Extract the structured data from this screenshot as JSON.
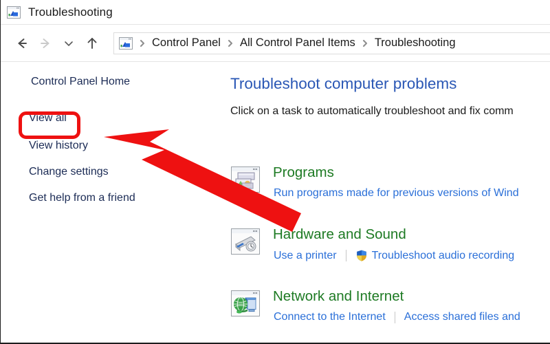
{
  "window": {
    "title": "Troubleshooting",
    "icon": "troubleshooting-window-icon"
  },
  "toolbar": {
    "back_icon": "back-arrow-icon",
    "forward_icon": "forward-arrow-icon",
    "recent_icon": "chevron-down-icon",
    "up_icon": "up-arrow-icon",
    "address_icon": "control-panel-icon",
    "breadcrumb": [
      "Control Panel",
      "All Control Panel Items",
      "Troubleshooting"
    ],
    "separator_icon": "chevron-right-icon"
  },
  "sidebar": {
    "home_label": "Control Panel Home",
    "items": [
      {
        "label": "View all"
      },
      {
        "label": "View history"
      },
      {
        "label": "Change settings"
      },
      {
        "label": "Get help from a friend"
      }
    ]
  },
  "main": {
    "title": "Troubleshoot computer problems",
    "subtitle": "Click on a task to automatically troubleshoot and fix comm",
    "categories": [
      {
        "icon": "programs-icon",
        "title": "Programs",
        "links": [
          {
            "label": "Run programs made for previous versions of Wind",
            "shield": false
          }
        ]
      },
      {
        "icon": "hardware-and-sound-icon",
        "title": "Hardware and Sound",
        "links": [
          {
            "label": "Use a printer",
            "shield": false
          },
          {
            "label": "Troubleshoot audio recording",
            "shield": true
          }
        ]
      },
      {
        "icon": "network-and-internet-icon",
        "title": "Network and Internet",
        "links": [
          {
            "label": "Connect to the Internet",
            "shield": false
          },
          {
            "label": "Access shared files and",
            "shield": false
          }
        ]
      }
    ]
  },
  "annotations": {
    "highlight_color": "#ee1111",
    "arrow_color": "#ee1111",
    "highlight_target": "View all",
    "arrow_points_to": "View all"
  },
  "colors": {
    "title_blue": "#2a57b5",
    "category_green": "#1d7a23",
    "link_blue": "#2a6fd8",
    "nav_navy": "#1b2b55",
    "annotation_red": "#ee1111"
  }
}
